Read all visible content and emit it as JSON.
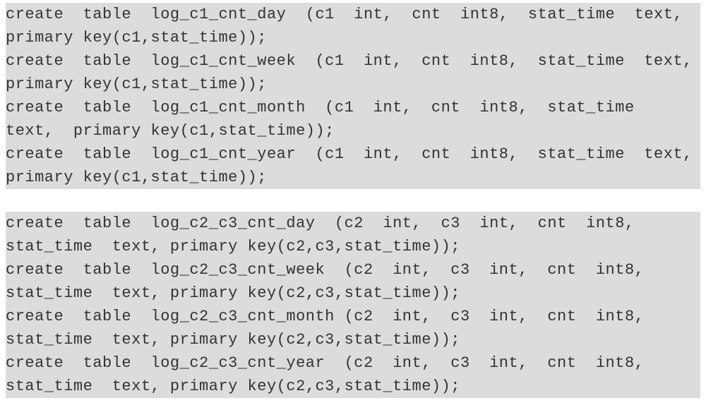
{
  "block1": {
    "statements": [
      "create  table  log_c1_cnt_day  (c1  int,  cnt  int8,  stat_time  text,  primary key(c1,stat_time));",
      "create  table  log_c1_cnt_week  (c1  int,  cnt  int8,  stat_time  text,  primary key(c1,stat_time));",
      "create  table  log_c1_cnt_month  (c1  int,  cnt  int8,  stat_time  text,  primary key(c1,stat_time));",
      "create  table  log_c1_cnt_year  (c1  int,  cnt  int8,  stat_time  text,  primary key(c1,stat_time));"
    ]
  },
  "block2": {
    "statements": [
      "create  table  log_c2_c3_cnt_day  (c2  int,  c3  int,  cnt  int8,  stat_time  text, primary key(c2,c3,stat_time));",
      "create  table  log_c2_c3_cnt_week  (c2  int,  c3  int,  cnt  int8,  stat_time  text, primary key(c2,c3,stat_time));",
      "create  table  log_c2_c3_cnt_month (c2  int,  c3  int,  cnt  int8,  stat_time  text, primary key(c2,c3,stat_time));",
      "create  table  log_c2_c3_cnt_year  (c2  int,  c3  int,  cnt  int8,  stat_time  text, primary key(c2,c3,stat_time));"
    ]
  }
}
